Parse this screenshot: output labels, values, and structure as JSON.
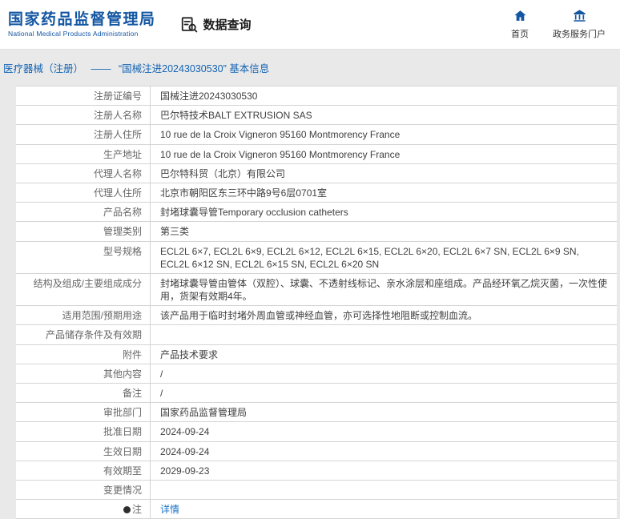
{
  "header": {
    "logo_title": "国家药品监督管理局",
    "logo_subtitle": "National Medical Products Administration",
    "section_title": "数据查询",
    "nav": [
      {
        "icon": "home-icon",
        "label": "首页"
      },
      {
        "icon": "building-icon",
        "label": "政务服务门户"
      }
    ]
  },
  "breadcrumb": {
    "category": "医疗器械（注册）",
    "separator": "——",
    "title": "“国械注进20243030530” 基本信息"
  },
  "table": {
    "rows": [
      {
        "label": "注册证编号",
        "value": "国械注进20243030530"
      },
      {
        "label": "注册人名称",
        "value": "巴尔特技术BALT EXTRUSION SAS"
      },
      {
        "label": "注册人住所",
        "value": "10 rue de la Croix Vigneron 95160 Montmorency France"
      },
      {
        "label": "生产地址",
        "value": "10 rue de la Croix Vigneron 95160 Montmorency France"
      },
      {
        "label": "代理人名称",
        "value": "巴尔特科贸（北京）有限公司"
      },
      {
        "label": "代理人住所",
        "value": "北京市朝阳区东三环中路9号6层0701室"
      },
      {
        "label": "产品名称",
        "value": "封堵球囊导管Temporary occlusion catheters"
      },
      {
        "label": "管理类别",
        "value": "第三类"
      },
      {
        "label": "型号规格",
        "value": "ECL2L 6×7, ECL2L 6×9, ECL2L 6×12, ECL2L 6×15, ECL2L 6×20, ECL2L 6×7 SN, ECL2L 6×9 SN, ECL2L 6×12 SN, ECL2L 6×15 SN, ECL2L 6×20 SN"
      },
      {
        "label": "结构及组成/主要组成成分",
        "value": "封堵球囊导管由管体（双腔）、球囊、不透射线标记、亲水涂层和座组成。产品经环氧乙烷灭菌，一次性使用，货架有效期4年。"
      },
      {
        "label": "适用范围/预期用途",
        "value": "该产品用于临时封堵外周血管或神经血管，亦可选择性地阻断或控制血流。"
      },
      {
        "label": "产品储存条件及有效期",
        "value": ""
      },
      {
        "label": "附件",
        "value": "产品技术要求"
      },
      {
        "label": "其他内容",
        "value": "/"
      },
      {
        "label": "备注",
        "value": "/"
      },
      {
        "label": "审批部门",
        "value": "国家药品监督管理局"
      },
      {
        "label": "批准日期",
        "value": "2024-09-24"
      },
      {
        "label": "生效日期",
        "value": "2024-09-24"
      },
      {
        "label": "有效期至",
        "value": "2029-09-23"
      },
      {
        "label": "变更情况",
        "value": ""
      },
      {
        "label": "注",
        "label_icon": "bullet-icon",
        "value": "详情",
        "link": true
      }
    ]
  },
  "colors": {
    "brand_blue": "#1356a2",
    "breadcrumb_blue": "#1464b4",
    "link_blue": "#1a73c7",
    "page_bg": "#e9e9e9"
  }
}
